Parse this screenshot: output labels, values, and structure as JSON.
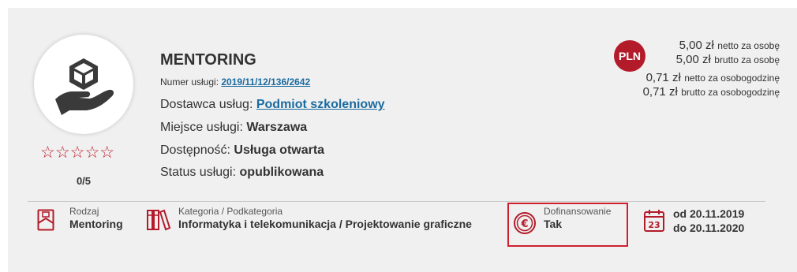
{
  "service": {
    "title": "MENTORING",
    "number_label": "Numer usługi:",
    "number_value": "2019/11/12/136/2642",
    "provider_label": "Dostawca usług:",
    "provider_value": "Podmiot szkoleniowy",
    "place_label": "Miejsce usługi:",
    "place_value": "Warszawa",
    "availability_label": "Dostępność:",
    "availability_value": "Usługa otwarta",
    "status_label": "Status usługi:",
    "status_value": "opublikowana"
  },
  "rating": {
    "stars": "☆☆☆☆☆",
    "text": "0/5",
    "value": 0,
    "max": 5
  },
  "price": {
    "currency_badge": "PLN",
    "line1_amount": "5,00 zł",
    "line1_suffix": "netto za osobę",
    "line2_amount": "5,00 zł",
    "line2_suffix": "brutto za osobę",
    "line3_amount": "0,71 zł",
    "line3_suffix": "netto za osobogodzinę",
    "line4_amount": "0,71 zł",
    "line4_suffix": "brutto za osobogodzinę"
  },
  "footer": {
    "type_label": "Rodzaj",
    "type_value": "Mentoring",
    "category_label": "Kategoria / Podkategoria",
    "category_value": "Informatyka i telekomunikacja / Projektowanie graficzne",
    "funding_label": "Dofinansowanie",
    "funding_value": "Tak",
    "date_from": "od 20.11.2019",
    "date_to": "do 20.11.2020",
    "calendar_day": "23"
  },
  "colors": {
    "accent": "#b31b2a",
    "link": "#1a6ba0",
    "highlight_border": "#d0202e",
    "card_bg": "#f0f0f0"
  },
  "icons": {
    "logo": "hand-holding-box-icon",
    "type": "envelope-document-icon",
    "category": "books-icon",
    "funding": "euro-coin-icon",
    "date": "calendar-icon"
  }
}
